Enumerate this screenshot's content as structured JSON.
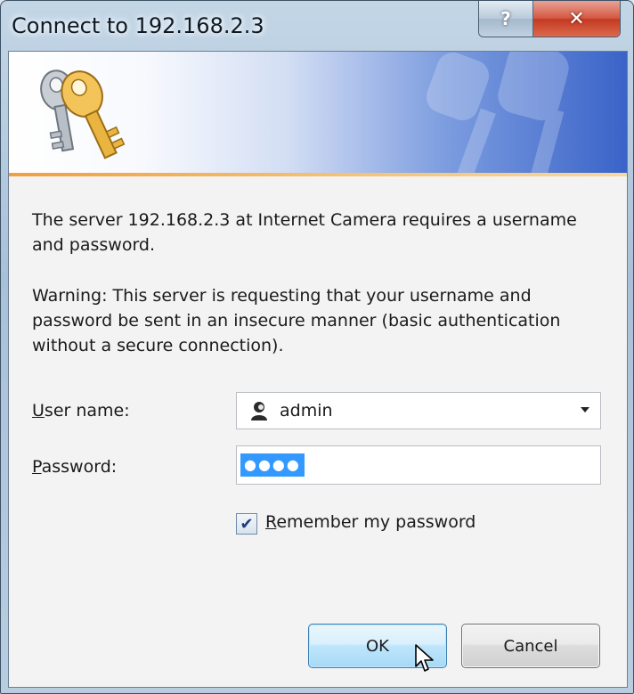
{
  "window": {
    "title": "Connect to 192.168.2.3",
    "help_glyph": "?",
    "close_glyph": "✕"
  },
  "message": {
    "intro": "The server 192.168.2.3 at Internet Camera requires a username and password.",
    "warning": "Warning: This server is requesting that your username and password be sent in an insecure manner (basic authentication without a secure connection)."
  },
  "form": {
    "username_label_first": "U",
    "username_label_rest": "ser name:",
    "username_value": "admin",
    "password_label_first": "P",
    "password_label_rest": "assword:",
    "password_mask": "●●●●",
    "remember_checked_glyph": "✔",
    "remember_label_first": "R",
    "remember_label_rest": "emember my password",
    "remember_checked": true
  },
  "buttons": {
    "ok_label": "OK",
    "cancel_label": "Cancel"
  },
  "icons": {
    "banner": "keys-icon",
    "user": "user-account-icon",
    "dropdown": "chevron-down-icon",
    "cursor": "mouse-pointer-icon"
  }
}
